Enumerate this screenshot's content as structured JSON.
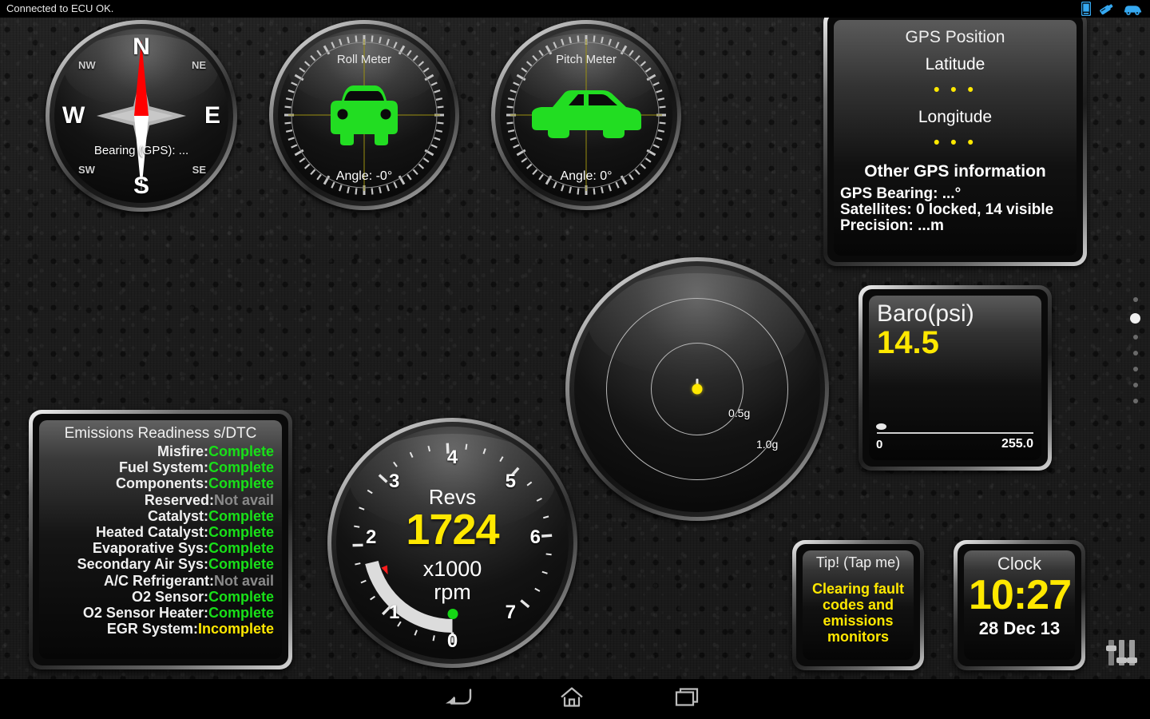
{
  "statusbar": {
    "text": "Connected to ECU OK.",
    "icons": [
      "tablet-icon",
      "obd-dongle-icon",
      "car-icon"
    ]
  },
  "compass": {
    "name": "compass-gauge",
    "north": "N",
    "south": "S",
    "west": "W",
    "east": "E",
    "nw": "NW",
    "ne": "NE",
    "sw": "SW",
    "se": "SE",
    "bearing_label": "Bearing (GPS): ...",
    "needle_color": "#ff0000"
  },
  "roll_meter": {
    "title": "Roll Meter",
    "angle": "Angle: -0°",
    "car_color": "#22dd22",
    "crosshair_color": "#9a8f10"
  },
  "pitch_meter": {
    "title": "Pitch Meter",
    "angle": "Angle: 0°",
    "car_color": "#22dd22",
    "crosshair_color": "#9a8f10"
  },
  "gps": {
    "title": "GPS Position",
    "latitude_label": "Latitude",
    "latitude_value": "• • •",
    "longitude_label": "Longitude",
    "longitude_value": "• • •",
    "other_header": "Other GPS information",
    "bearing": "GPS Bearing: ...°",
    "satellites": "Satellites: 0 locked, 14 visible",
    "precision": "Precision: ...m"
  },
  "baro": {
    "name": "Baro(psi)",
    "value": "14.5",
    "min": "0",
    "max": "255.0"
  },
  "gmeter": {
    "ring_inner_label": "0.5g",
    "ring_outer_label": "1.0g",
    "dot_color": "#ffe800"
  },
  "tach": {
    "title": "Revs",
    "value": "1724",
    "unit_line1": "x1000",
    "unit_line2": "rpm",
    "ticks": [
      "0",
      "1",
      "2",
      "3",
      "4",
      "5",
      "6",
      "7"
    ],
    "value_color": "#ffe800",
    "arc_value": 1.724,
    "marker_value": 1.5
  },
  "emissions": {
    "title": "Emissions Readiness s/DTC",
    "rows": [
      {
        "label": "Misfire:",
        "status": "Complete",
        "state": "ok"
      },
      {
        "label": "Fuel System:",
        "status": "Complete",
        "state": "ok"
      },
      {
        "label": "Components:",
        "status": "Complete",
        "state": "ok"
      },
      {
        "label": "Reserved:",
        "status": "Not avail",
        "state": "na"
      },
      {
        "label": "Catalyst:",
        "status": "Complete",
        "state": "ok"
      },
      {
        "label": "Heated Catalyst:",
        "status": "Complete",
        "state": "ok"
      },
      {
        "label": "Evaporative Sys:",
        "status": "Complete",
        "state": "ok"
      },
      {
        "label": "Secondary Air Sys:",
        "status": "Complete",
        "state": "ok"
      },
      {
        "label": "A/C Refrigerant:",
        "status": "Not avail",
        "state": "na"
      },
      {
        "label": "O2 Sensor:",
        "status": "Complete",
        "state": "ok"
      },
      {
        "label": "O2 Sensor Heater:",
        "status": "Complete",
        "state": "ok"
      },
      {
        "label": "EGR System:",
        "status": "Incomplete",
        "state": "inc"
      }
    ]
  },
  "tip": {
    "title": "Tip! (Tap me)",
    "text": "Clearing fault codes and emissions monitors"
  },
  "clock": {
    "title": "Clock",
    "time": "10:27",
    "date": "28 Dec 13"
  },
  "page_indicator": {
    "count": 7,
    "active_index": 1
  },
  "settings": {
    "icon": "sliders-icon"
  },
  "navbar": {
    "back": "back-icon",
    "home": "home-icon",
    "recents": "recents-icon"
  },
  "colors": {
    "accent_yellow": "#ffe800",
    "ok_green": "#18e018",
    "na_gray": "#8a8a8a",
    "needle_red": "#ff0000",
    "status_blue": "#35a8f0"
  }
}
